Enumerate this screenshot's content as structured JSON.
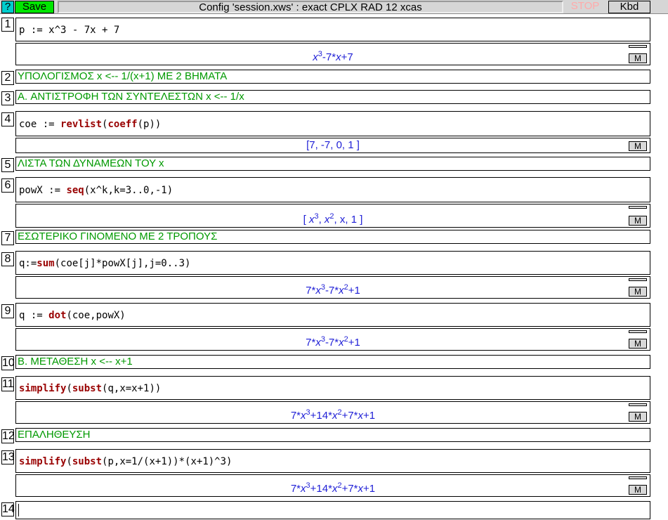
{
  "toolbar": {
    "help_label": "?",
    "save_label": "Save",
    "config_label": "Config 'session.xws' : exact CPLX RAD 12 xcas",
    "stop_label": "STOP",
    "kbd_label": "Kbd"
  },
  "levels": [
    {
      "num": "1",
      "input": "p := x^3 - 7x + 7",
      "output_parts": [
        "x",
        "3",
        "-7*",
        "x",
        "+7"
      ]
    },
    {
      "num": "2",
      "comment": "ΥΠΟΛΟΓΙΣΜΟΣ  x <-- 1/(x+1) ΜΕ 2 ΒΗΜΑΤΑ"
    },
    {
      "num": "3",
      "comment": "A.   ΑΝΤΙΣΤΡΟΦΗ ΤΩΝ ΣΥΝΤΕΛΕΣΤΩΝ  x <-- 1/x"
    },
    {
      "num": "4",
      "input_pre": "coe := ",
      "input_kw1": "revlist",
      "input_mid": "(",
      "input_kw2": "coeff",
      "input_post": "(p))",
      "output": "[7,  -7,  0,  1 ]"
    },
    {
      "num": "5",
      "comment": "ΛΙΣΤΑ ΤΩΝ ΔΥΝΑΜΕΩΝ ΤΟΥ x"
    },
    {
      "num": "6",
      "input_pre": "powX := ",
      "input_kw1": "seq",
      "input_post": "(x^k,k=3..0,-1)",
      "output_parts": [
        "x",
        "3",
        ",  ",
        "x",
        "2",
        ",  x,  1"
      ]
    },
    {
      "num": "7",
      "comment": "ΕΣΩΤΕΡΙΚΟ ΓΙΝΟΜΕΝΟ ΜΕ 2 ΤΡΟΠΟΥΣ"
    },
    {
      "num": "8",
      "input_pre": "q:=",
      "input_kw1": "sum",
      "input_post": "(coe[j]*powX[j],j=0..3)",
      "output_parts": [
        "7*",
        "x",
        "3",
        "-7*",
        "x",
        "2",
        "+1"
      ]
    },
    {
      "num": "9",
      "input_pre": "q := ",
      "input_kw1": "dot",
      "input_post": "(coe,powX)",
      "output_parts": [
        "7*",
        "x",
        "3",
        "-7*",
        "x",
        "2",
        "+1"
      ]
    },
    {
      "num": "10",
      "comment": "B.  ΜΕΤΑΘΕΣΗ x <-- x+1"
    },
    {
      "num": "11",
      "input_kw1": "simplify",
      "input_mid": "(",
      "input_kw2": "subst",
      "input_post": "(q,x=x+1))",
      "output_parts": [
        "7*",
        "x",
        "3",
        "+14*",
        "x",
        "2",
        "+7*",
        "x",
        "+1"
      ]
    },
    {
      "num": "12",
      "comment": "ΕΠΑΛΗΘΕΥΣΗ"
    },
    {
      "num": "13",
      "input_kw1": "simplify",
      "input_mid": "(",
      "input_kw2": "subst",
      "input_post": "(p,x=1/(x+1))*(x+1)^3)",
      "output_parts": [
        "7*",
        "x",
        "3",
        "+14*",
        "x",
        "2",
        "+7*",
        "x",
        "+1"
      ]
    },
    {
      "num": "14",
      "input": ""
    }
  ],
  "m_label": "M",
  "colors": {
    "comment": "#009900",
    "keyword": "#990000",
    "output": "#1f1fd6",
    "save": "#00e600",
    "help": "#00cccc"
  }
}
